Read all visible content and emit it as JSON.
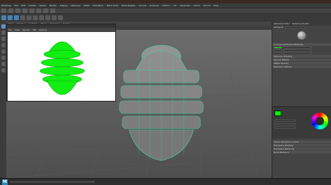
{
  "menus": {
    "main": [
      "File",
      "Edit",
      "Create",
      "Select",
      "Modify",
      "Display",
      "Windows",
      "Mesh",
      "Edit Mesh",
      "Mesh Tools",
      "Mesh Display",
      "Curves",
      "Surfaces",
      "Deform",
      "UV",
      "Generate",
      "Cache",
      "Arnold",
      "Help"
    ],
    "viewport": [
      "View",
      "Shading",
      "Lighting",
      "Show",
      "Renderer",
      "Panels"
    ],
    "render_view": [
      "File",
      "View",
      "Render",
      "IPR",
      "Options"
    ]
  },
  "workspace": "Modeling",
  "attr": {
    "tabs": [
      "Attribute Editor",
      "Modeling Toolkit"
    ],
    "material_name": "lambert2",
    "sections": [
      "Common Material Attributes",
      "Specular Shading",
      "Special Effects",
      "Matte Opacity",
      "Raytrace Options",
      "Vector Renderer Control",
      "Hardware Shading",
      "Hardware Texturing",
      "Node Behavior"
    ]
  },
  "colors": {
    "accent_green": "#00ff00",
    "mesh_outline": "#3fd3a6",
    "mesh_face": "#8a8a8a"
  },
  "timeline": {
    "logo": "M"
  }
}
